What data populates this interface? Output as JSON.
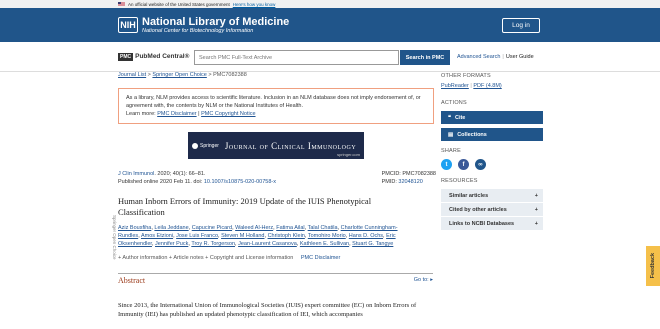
{
  "gov_banner": {
    "text": "An official website of the United States government",
    "link": "Here's how you know"
  },
  "header": {
    "logo_abbr": "NIH",
    "title": "National Library of Medicine",
    "subtitle": "National Center for Biotechnology Information",
    "login": "Log in"
  },
  "pmc": {
    "logo_box": "PMC",
    "logo_text": "PubMed Central®",
    "search_placeholder": "Search PMC Full-Text Archive",
    "search_button": "Search in PMC",
    "advanced": "Advanced Search",
    "guide": "User Guide"
  },
  "breadcrumb": {
    "journal_list": "Journal List",
    "sep1": ">",
    "open_choice": "Springer Open Choice",
    "sep2": ">",
    "pmc_id": "PMC7082388"
  },
  "notice": {
    "text": "As a library, NLM provides access to scientific literature. Inclusion in an NLM database does not imply endorsement of, or agreement with, the contents by NLM or the National Institutes of Health.",
    "learn_more": "Learn more:",
    "disclaimer": "PMC Disclaimer",
    "sep": "|",
    "copyright": "PMC Copyright Notice"
  },
  "journal_banner": {
    "publisher": "Springer",
    "name": "Journal of Clinical Immunology",
    "url": "springer.com"
  },
  "citation": {
    "journal": "J Clin Immunol",
    "details": ". 2020; 40(1): 66–81.",
    "published": "Published online 2020 Feb 11. doi:",
    "doi": "10.1007/s10875-020-00758-x",
    "pmcid_label": "PMCID: PMC7082388",
    "pmid_label": "PMID:",
    "pmid": "32048120"
  },
  "article": {
    "title": "Human Inborn Errors of Immunity: 2019 Update of the IUIS Phenotypical Classification",
    "authors": [
      "Aziz Bousfiha",
      "Leila Jeddane",
      "Capucine Picard",
      "Waleed Al-Herz",
      "Fatima Ailal",
      "Talal Chatila",
      "Charlotte Cunningham-Rundles",
      "Amos Etzioni",
      "Jose Luis Franco",
      "Steven M Holland",
      "Christoph Klein",
      "Tomohiro Morio",
      "Hans D. Ochs",
      "Eric Oksenhendler",
      "Jennifer Puck",
      "Troy R. Torgerson",
      "Jean-Laurent Casanova",
      "Kathleen E. Sullivan",
      "Stuart G. Tangye"
    ],
    "author_info": "+ Author information  + Article notes  + Copyright and License information",
    "disclaimer": "PMC Disclaimer",
    "side_label": "Springer Open Choice"
  },
  "abstract": {
    "title": "Abstract",
    "goto": "Go to: ▸",
    "text": "Since 2013, the International Union of Immunological Societies (IUIS) expert committee (EC) on Inborn Errors of Immunity (IEI) has published an updated phenotypic classification of IEI, which accompanies"
  },
  "sidebar": {
    "other_formats": "OTHER FORMATS",
    "pubreader": "PubReader",
    "pdf": "PDF (4.8M)",
    "actions": "ACTIONS",
    "cite": "Cite",
    "collections": "Collections",
    "share": "SHARE",
    "resources": "RESOURCES",
    "resources_items": [
      "Similar articles",
      "Cited by other articles",
      "Links to NCBI Databases"
    ]
  },
  "feedback": "Feedback",
  "colors": {
    "header": "#20558a",
    "link": "#205493",
    "abstract": "#9b3b1b",
    "twitter": "#1da1f2",
    "facebook": "#3b5998"
  }
}
